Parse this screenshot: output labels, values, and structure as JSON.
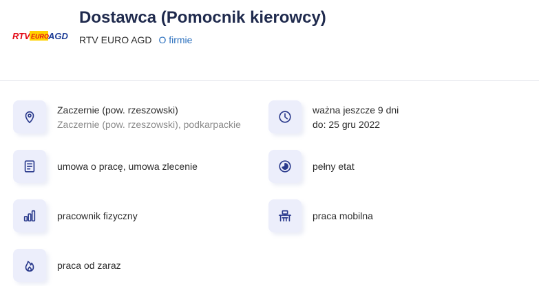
{
  "header": {
    "job_title": "Dostawca (Pomocnik kierowcy)",
    "company_name": "RTV EURO AGD",
    "about_link": "O firmie",
    "logo": {
      "text_rtv": "RTV",
      "text_euro": "EURO",
      "text_agd": "AGD",
      "brand_red": "#e30613",
      "brand_yellow": "#ffd200",
      "brand_blue": "#1d3c96"
    }
  },
  "details": {
    "location": {
      "icon": "location-pin-icon",
      "primary": "Zaczernie (pow. rzeszowski)",
      "secondary": "Zaczernie (pow. rzeszowski), podkarpackie"
    },
    "validity": {
      "icon": "clock-icon",
      "primary": "ważna jeszcze 9 dni",
      "secondary": "do: 25 gru 2022"
    },
    "contract": {
      "icon": "document-icon",
      "primary": "umowa o pracę, umowa zlecenie"
    },
    "worktime": {
      "icon": "pie-chart-icon",
      "primary": "pełny etat"
    },
    "level": {
      "icon": "bar-chart-icon",
      "primary": "pracownik fizyczny"
    },
    "mode": {
      "icon": "desk-icon",
      "primary": "praca mobilna"
    },
    "start": {
      "icon": "flame-icon",
      "primary": "praca od zaraz"
    }
  },
  "colors": {
    "title": "#1f2a4d",
    "link": "#2a6fbd",
    "icon_tile": "#eceefb",
    "icon_stroke": "#2a3a8c"
  }
}
